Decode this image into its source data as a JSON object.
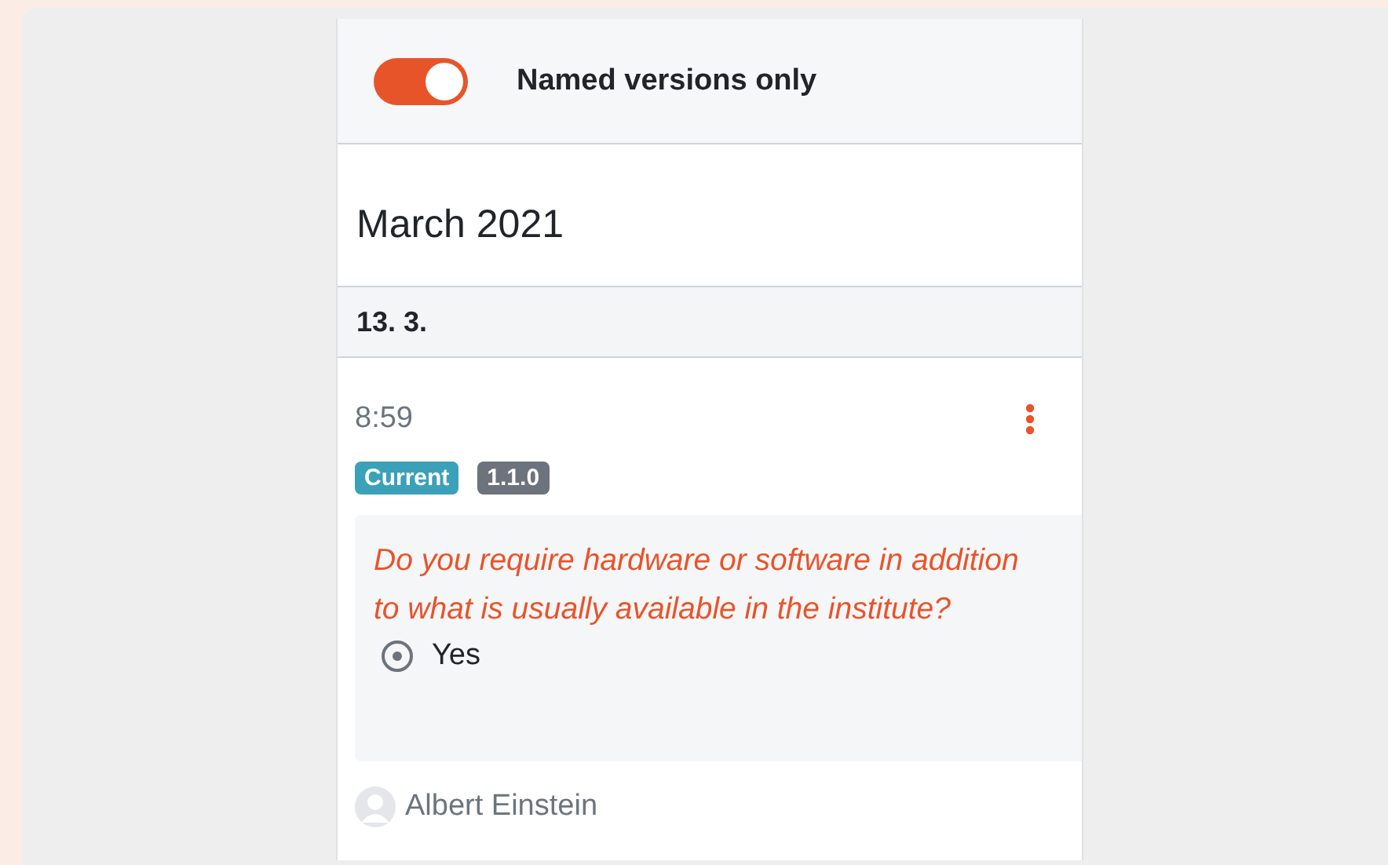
{
  "filter": {
    "label": "Named versions only",
    "on": true
  },
  "month": "March 2021",
  "days": [
    {
      "date": "13. 3.",
      "versions": [
        {
          "time": "8:59",
          "tags": [
            {
              "label": "Current",
              "color": "#3ba1b8"
            },
            {
              "label": "1.1.0",
              "color": "#6c737c"
            }
          ],
          "question": "Do you require hardware or software in addition to what is usually available in the institute?",
          "answers": [
            {
              "label": "Yes",
              "selected": true
            }
          ],
          "author": "Albert Einstein"
        }
      ]
    }
  ]
}
